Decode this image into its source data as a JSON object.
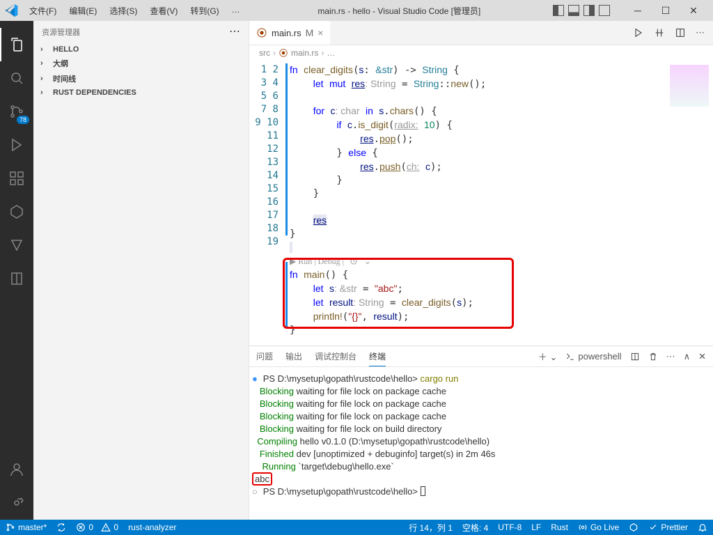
{
  "menu": {
    "file": "文件(F)",
    "edit": "编辑(E)",
    "select": "选择(S)",
    "view": "查看(V)",
    "goto": "转到(G)",
    "more": "…"
  },
  "title": "main.rs - hello - Visual Studio Code [管理员]",
  "sidebar": {
    "title": "资源管理器",
    "items": [
      {
        "label": "HELLO"
      },
      {
        "label": "大纲"
      },
      {
        "label": "时间线"
      },
      {
        "label": "RUST DEPENDENCIES"
      }
    ]
  },
  "activity_badge": "78",
  "tab": {
    "file": "main.rs",
    "mod": "M"
  },
  "breadcrumb": {
    "a": "src",
    "b": "main.rs",
    "c": "…"
  },
  "codelens": "▶ Run | Debug |",
  "panel": {
    "tabs": [
      "问题",
      "输出",
      "调试控制台",
      "终端"
    ],
    "shell": "powershell",
    "prompt1": "PS D:\\mysetup\\gopath\\rustcode\\hello> ",
    "cmd": "cargo run",
    "blk": "   Blocking",
    "blk_msg": " waiting for file lock on package cache",
    "blk_msg2": " waiting for file lock on build directory",
    "compiling": "  Compiling",
    "comp_msg": " hello v0.1.0 (D:\\mysetup\\gopath\\rustcode\\hello)",
    "finished": "   Finished",
    "fin_msg": " dev [unoptimized + debuginfo] target(s) in 2m 46s",
    "running": "    Running",
    "run_msg": " `target\\debug\\hello.exe`",
    "output": "abc",
    "prompt2": "PS D:\\mysetup\\gopath\\rustcode\\hello> "
  },
  "status": {
    "branch": "master*",
    "sync": "",
    "errors": "0",
    "warnings": "0",
    "analyzer": "rust-analyzer",
    "pos": "行 14，列 1",
    "spaces": "空格: 4",
    "enc": "UTF-8",
    "eol": "LF",
    "lang": "Rust",
    "golive": "Go Live",
    "prettier": "Prettier"
  }
}
